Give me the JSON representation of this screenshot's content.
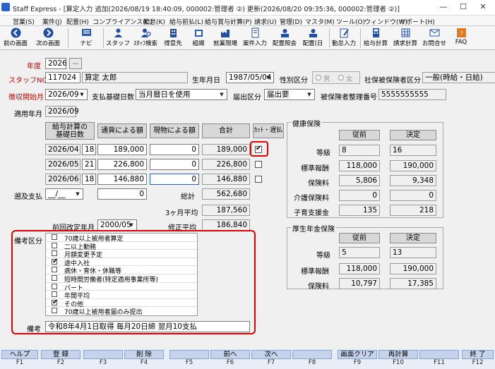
{
  "window": {
    "title": "Staff Express - [算定入力  追加(2026/08/19 18:40:09, 000002:管理者  ②)  更新(2026/08/20 09:35:36, 000002:管理者  ②)]",
    "buttons": {
      "minimize": "—",
      "maximize": "☐",
      "close": "✕"
    }
  },
  "menu": [
    "営業(S)",
    "案件(J)",
    "配置(H)",
    "コンプライアンス(C)",
    "勤怠(K)",
    "給与前払(L)",
    "給与賞与計算(P)",
    "請求(U)",
    "管理(D)",
    "マスタ(M)",
    "ツール(O)",
    "ウィンドウ(W)",
    "サポート(H)"
  ],
  "toolbar": {
    "prev": "前の画面",
    "next": "次の画面",
    "navi": "ナビ",
    "staff": "スタッフ",
    "staff_search": "ｽﾀｯﾌ検索",
    "client": "得意先",
    "org": "組織",
    "site": "就業現場",
    "case_input": "案件入力",
    "assign_view": "配置照会",
    "assign_day": "配置(日",
    "attend_input": "勤怠入力",
    "pay_calc": "給与計算",
    "bill_calc": "請求計算",
    "contact": "お問合せ",
    "faq": "FAQ"
  },
  "form": {
    "year_label": "年度",
    "year": "2026",
    "dots": "...",
    "staff_label": "スタッフNO",
    "staff_no": "117024",
    "staff_name": "算定  太郎",
    "birth_label": "生年月日",
    "birth": "1987/05/04",
    "gender_label": "性別区分",
    "gender_m": "男",
    "gender_f": "女",
    "insured_label": "社保被保険者区分",
    "insured": "一般(時給・日給)",
    "start_label": "徴収開始月",
    "start": "2026/09",
    "basis_label": "支払基礎日数",
    "basis": "当月暦日を使用",
    "notify_label": "届出区分",
    "notify": "届出要",
    "number_label": "被保険者整理番号",
    "number": "5555555555",
    "apply_label": "適用年月",
    "apply": "2026/09"
  },
  "calc": {
    "h_month": "給与計算の\n基礎日数",
    "h_cash": "通貨による額",
    "h_kind": "現物による額",
    "h_total": "合計",
    "h_cut": "ｶｯﾄ・遅払",
    "rows": [
      {
        "month": "2026/04",
        "days": "18",
        "cash": "189,000",
        "kind": "0",
        "total": "189,000",
        "cut": true
      },
      {
        "month": "2026/05",
        "days": "21",
        "cash": "226,800",
        "kind": "0",
        "total": "226,800",
        "cut": false
      },
      {
        "month": "2026/06",
        "days": "18",
        "cash": "146,880",
        "kind": "0",
        "total": "146,880",
        "cut": false
      }
    ],
    "retro_label": "遡及支払",
    "retro_date": "__/__",
    "retro_amount": "0",
    "sum_label": "総計",
    "sum": "562,680",
    "avg_label": "3ヶ月平均",
    "avg": "187,560",
    "prev_label": "前回改定年月",
    "prev": "2000/05",
    "revised_label": "修正平均",
    "revised": "186,840"
  },
  "health": {
    "title": "健康保険",
    "before": "従前",
    "after": "決定",
    "rows": [
      {
        "label": "等級",
        "before": "8",
        "after": "16"
      },
      {
        "label": "標準報酬",
        "before": "118,000",
        "after": "190,000"
      },
      {
        "label": "保険料",
        "before": "5,806",
        "after": "9,348"
      },
      {
        "label": "介護保険料",
        "before": "0",
        "after": "0"
      },
      {
        "label": "子育支援金",
        "before": "135",
        "after": "218"
      }
    ]
  },
  "pension": {
    "title": "厚生年金保険",
    "before": "従前",
    "after": "決定",
    "rows": [
      {
        "label": "等級",
        "before": "5",
        "after": "13"
      },
      {
        "label": "標準報酬",
        "before": "118,000",
        "after": "190,000"
      },
      {
        "label": "保険料",
        "before": "10,797",
        "after": "17,385"
      }
    ]
  },
  "remarks": {
    "kubun_label": "備考区分",
    "items": [
      {
        "label": "70歳以上被用者算定",
        "checked": false
      },
      {
        "label": "二以上勤務",
        "checked": false
      },
      {
        "label": "月額変更予定",
        "checked": false
      },
      {
        "label": "途中入社",
        "checked": true
      },
      {
        "label": "病休・育休・休職等",
        "checked": false
      },
      {
        "label": "短時間労働者(特定適用事業所等)",
        "checked": false
      },
      {
        "label": "パート",
        "checked": false
      },
      {
        "label": "年間平均",
        "checked": false
      },
      {
        "label": "その他",
        "checked": true
      },
      {
        "label": "70歳以上被用者届のみ提出",
        "checked": false
      }
    ],
    "note_label": "備考",
    "note": "令和8年4月1日取得  毎月20日締  翌月10支払"
  },
  "fkeys": [
    {
      "key": "F1",
      "label": "ヘルプ"
    },
    {
      "key": "F2",
      "label": "登 録"
    },
    {
      "key": "F3",
      "label": ""
    },
    {
      "key": "F4",
      "label": "削 除"
    },
    {
      "key": "F5",
      "label": ""
    },
    {
      "key": "F6",
      "label": "前へ"
    },
    {
      "key": "F7",
      "label": "次へ"
    },
    {
      "key": "F8",
      "label": ""
    },
    {
      "key": "F9",
      "label": "画面クリア"
    },
    {
      "key": "F10",
      "label": "再計算"
    },
    {
      "key": "F11",
      "label": ""
    },
    {
      "key": "F12",
      "label": "終 了"
    }
  ],
  "colors": {
    "accent_red": "#e00000",
    "label_red": "#d00000",
    "fkey_bg": "#c5d4ec"
  }
}
